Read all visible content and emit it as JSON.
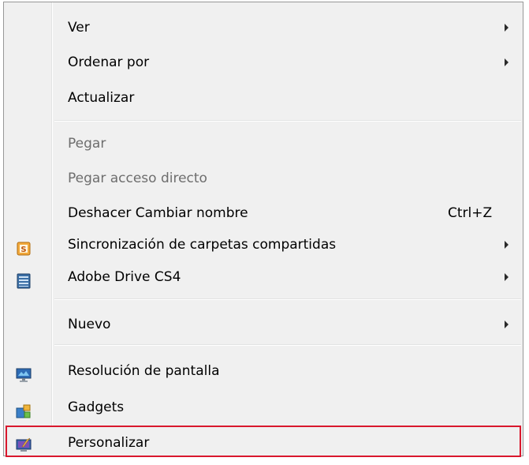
{
  "menu": {
    "items": [
      {
        "label": "Ver",
        "submenu": true
      },
      {
        "label": "Ordenar por",
        "submenu": true
      },
      {
        "label": "Actualizar"
      },
      {
        "label": "Pegar",
        "disabled": true
      },
      {
        "label": "Pegar acceso directo",
        "disabled": true
      },
      {
        "label": "Deshacer Cambiar nombre",
        "shortcut": "Ctrl+Z"
      },
      {
        "label": "Sincronización de carpetas compartidas",
        "submenu": true,
        "icon": "sharepoint-sync-icon"
      },
      {
        "label": "Adobe Drive CS4",
        "submenu": true,
        "icon": "adobe-drive-icon"
      },
      {
        "label": "Nuevo",
        "submenu": true
      },
      {
        "label": "Resolución de pantalla",
        "icon": "screen-resolution-icon"
      },
      {
        "label": "Gadgets",
        "icon": "gadgets-icon"
      },
      {
        "label": "Personalizar",
        "icon": "personalize-icon",
        "highlighted": true
      }
    ]
  },
  "colors": {
    "menu_background": "#f0f0f0",
    "highlight_border": "#d9182d",
    "disabled_text": "#6d6d6d",
    "separator": "#e2e3e3"
  }
}
